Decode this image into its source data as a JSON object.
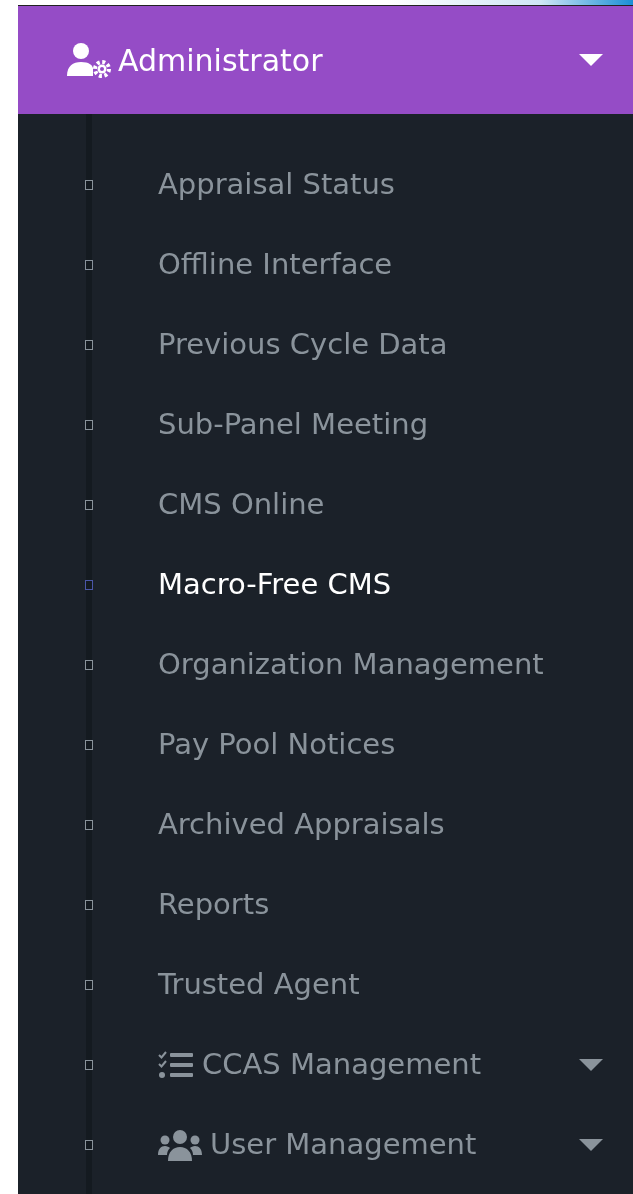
{
  "header": {
    "title": "Administrator",
    "expanded": true
  },
  "items": [
    {
      "kind": "link",
      "label": "Appraisal Status",
      "selected": false
    },
    {
      "kind": "link",
      "label": "Offline Interface",
      "selected": false
    },
    {
      "kind": "link",
      "label": "Previous Cycle Data",
      "selected": false
    },
    {
      "kind": "link",
      "label": "Sub-Panel Meeting",
      "selected": false
    },
    {
      "kind": "link",
      "label": "CMS Online",
      "selected": false
    },
    {
      "kind": "link",
      "label": "Macro-Free CMS",
      "selected": true
    },
    {
      "kind": "link",
      "label": "Organization Management",
      "selected": false
    },
    {
      "kind": "link",
      "label": "Pay Pool Notices",
      "selected": false
    },
    {
      "kind": "link",
      "label": "Archived Appraisals",
      "selected": false
    },
    {
      "kind": "link",
      "label": "Reports",
      "selected": false
    },
    {
      "kind": "link",
      "label": "Trusted Agent",
      "selected": false
    },
    {
      "kind": "checklist-submenu",
      "label": "CCAS Management",
      "selected": false,
      "expanded": false
    },
    {
      "kind": "users-submenu",
      "label": "User Management",
      "selected": false,
      "expanded": false
    }
  ]
}
